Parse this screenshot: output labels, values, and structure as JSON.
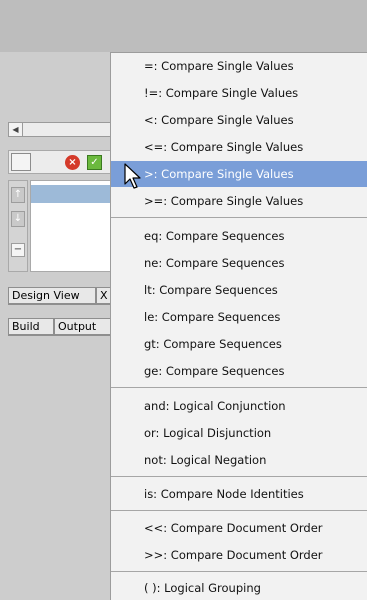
{
  "background": {
    "tabs_row1": [
      "Design View",
      "X"
    ],
    "tabs_row2": [
      "Build",
      "Output"
    ]
  },
  "menu": {
    "items": [
      {
        "label": "=: Compare Single Values",
        "highlighted": false
      },
      {
        "label": "!=: Compare Single Values",
        "highlighted": false
      },
      {
        "label": "<: Compare Single Values",
        "highlighted": false
      },
      {
        "label": "<=: Compare Single Values",
        "highlighted": false
      },
      {
        "label": ">: Compare Single Values",
        "highlighted": true
      },
      {
        "label": ">=: Compare Single Values",
        "highlighted": false
      },
      {
        "label": "eq: Compare Sequences",
        "highlighted": false
      },
      {
        "label": "ne: Compare Sequences",
        "highlighted": false
      },
      {
        "label": "lt: Compare Sequences",
        "highlighted": false
      },
      {
        "label": "le: Compare Sequences",
        "highlighted": false
      },
      {
        "label": "gt: Compare Sequences",
        "highlighted": false
      },
      {
        "label": "ge: Compare Sequences",
        "highlighted": false
      },
      {
        "label": "and: Logical Conjunction",
        "highlighted": false
      },
      {
        "label": "or: Logical Disjunction",
        "highlighted": false
      },
      {
        "label": "not: Logical Negation",
        "highlighted": false
      },
      {
        "label": "is: Compare Node Identities",
        "highlighted": false
      },
      {
        "label": "<<: Compare Document Order",
        "highlighted": false
      },
      {
        "label": ">>: Compare Document Order",
        "highlighted": false
      },
      {
        "label": "( ): Logical Grouping",
        "highlighted": false
      }
    ]
  },
  "colors": {
    "highlight": "#7a9ed8",
    "menu_bg": "#f2f2f2"
  }
}
